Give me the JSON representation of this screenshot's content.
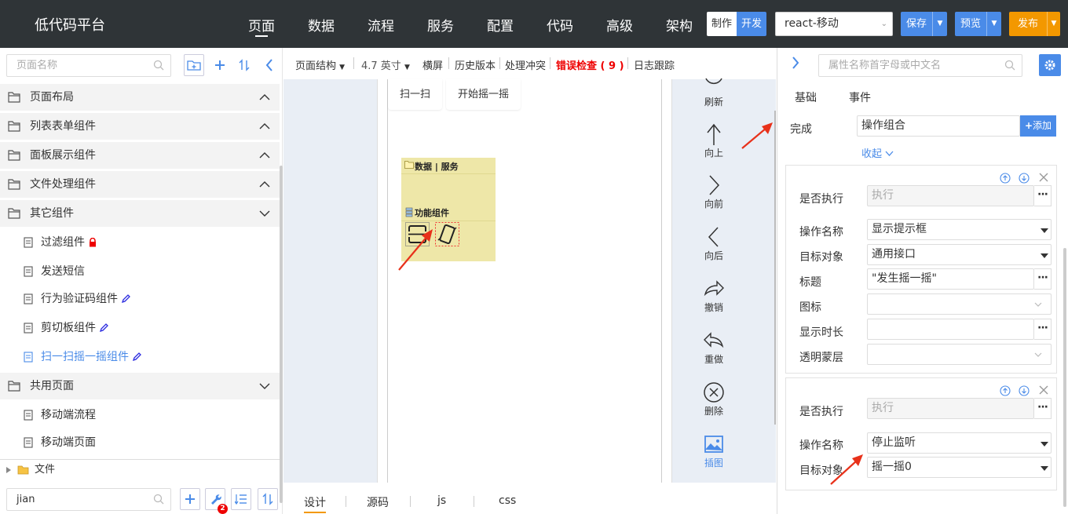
{
  "app": {
    "title": "低代码平台",
    "nav": [
      "页面",
      "数据",
      "流程",
      "服务",
      "配置",
      "代码",
      "高级",
      "架构"
    ],
    "mode_make": "制作",
    "mode_dev": "开发",
    "project_select": "react-移动",
    "save": "保存",
    "preview": "预览",
    "publish": "发布"
  },
  "left": {
    "search_placeholder": "页面名称",
    "groups": [
      {
        "label": "页面布局"
      },
      {
        "label": "列表表单组件"
      },
      {
        "label": "面板展示组件"
      },
      {
        "label": "文件处理组件"
      },
      {
        "label": "其它组件"
      }
    ],
    "items": [
      {
        "label": "过滤组件"
      },
      {
        "label": "发送短信"
      },
      {
        "label": "行为验证码组件"
      },
      {
        "label": "剪切板组件"
      },
      {
        "label": "扫一扫摇一摇组件"
      }
    ],
    "shared_group": "共用页面",
    "shared_items": [
      {
        "label": "移动端流程"
      },
      {
        "label": "移动端页面"
      }
    ],
    "files_label": "文件",
    "bottom_search_value": "jian",
    "bottom_badge": "2"
  },
  "toolbar": {
    "structure": "页面结构",
    "size": "4.7 英寸",
    "landscape": "横屏",
    "history": "历史版本",
    "conflict": "处理冲突",
    "errors": "错误检查 ( 9 )",
    "log": "日志跟踪"
  },
  "canvas": {
    "btn_scan": "扫一扫",
    "btn_shake": "开始摇一摇",
    "data_service": "数据 | 服务",
    "function_components": "功能组件",
    "actions": [
      {
        "label": "刷新"
      },
      {
        "label": "向上"
      },
      {
        "label": "向前"
      },
      {
        "label": "向后"
      },
      {
        "label": "撤销"
      },
      {
        "label": "重做"
      },
      {
        "label": "删除"
      },
      {
        "label": "插图"
      }
    ]
  },
  "bottom_tabs": [
    "设计",
    "源码",
    "js",
    "css"
  ],
  "right": {
    "search_placeholder": "属性名称首字母或中文名",
    "tab_basic": "基础",
    "tab_event": "事件",
    "complete_label": "完成",
    "complete_value": "操作组合",
    "add_button": "添加",
    "collapse": "收起",
    "card1": {
      "exec_label": "是否执行",
      "exec_placeholder": "执行",
      "op_label": "操作名称",
      "op_value": "显示提示框",
      "target_label": "目标对象",
      "target_value": "通用接口",
      "title_label": "标题",
      "title_value": "\"发生摇一摇\"",
      "icon_label": "图标",
      "duration_label": "显示时长",
      "mask_label": "透明蒙层"
    },
    "card2": {
      "exec_label": "是否执行",
      "exec_placeholder": "执行",
      "op_label": "操作名称",
      "op_value": "停止监听",
      "target_label": "目标对象",
      "target_value": "摇一摇0"
    }
  }
}
